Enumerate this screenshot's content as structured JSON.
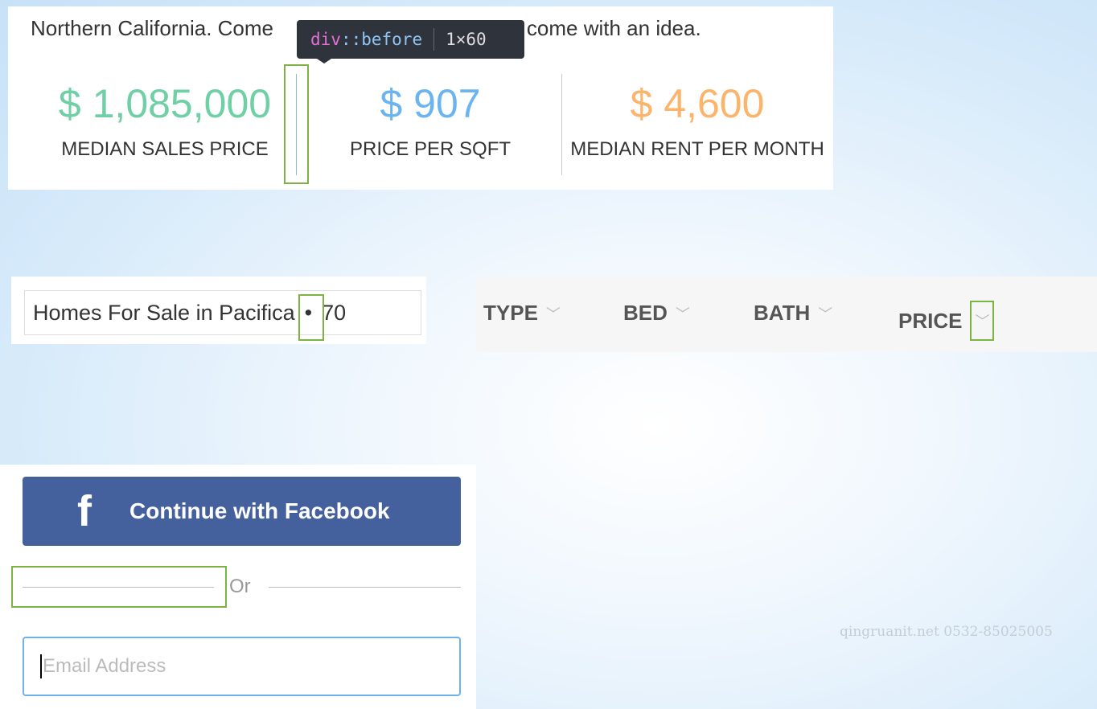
{
  "intro": {
    "text_left": "Northern California. Come",
    "text_right": "ust come with an idea."
  },
  "tooltip": {
    "selector_tag": "div",
    "selector_pseudo": "::before",
    "size": "1×60"
  },
  "stats": [
    {
      "value": "$ 1,085,000",
      "label": "MEDIAN SALES PRICE",
      "color": "#6fcfa5"
    },
    {
      "value": "$ 907",
      "label": "PRICE PER SQFT",
      "color": "#6cb4f0"
    },
    {
      "value": "$ 4,600",
      "label": "MEDIAN RENT PER MONTH",
      "color": "#fbb46b"
    }
  ],
  "search": {
    "title": "Homes For Sale in Pacifica",
    "separator": "•",
    "count": "70"
  },
  "filters": [
    {
      "label": "TYPE"
    },
    {
      "label": "BED"
    },
    {
      "label": "BATH"
    },
    {
      "label": "PRICE"
    }
  ],
  "login": {
    "facebook_label": "Continue with Facebook",
    "facebook_icon": "f",
    "or_label": "Or",
    "email_placeholder": "Email Address"
  },
  "watermark": "qingruanit.net 0532-85025005"
}
